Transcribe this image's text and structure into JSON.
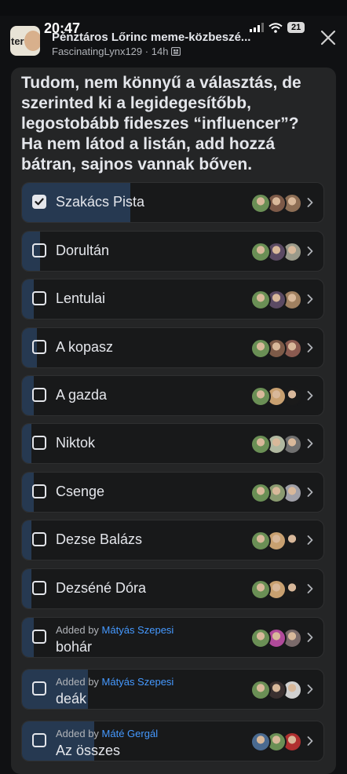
{
  "status_bar": {
    "time": "20:47",
    "battery": "21"
  },
  "header": {
    "group_avatar_text": "ter",
    "group_name": "Pénztáros Lőrinc meme-közbeszé...",
    "author": "FascinatingLynx129",
    "age": "14h",
    "separator": "·"
  },
  "poll": {
    "question": "Tudom, nem könnyű a választás, de szerinted ki a legidegesítőbb, legostobább fideszes “influencer”? Ha nem látod a listán, add hozzá bátran, sajnos vannak bőven.",
    "added_by_prefix": "Added by",
    "options": [
      {
        "label": "Szakács Pista",
        "checked": true,
        "vote_share": 0.36,
        "avatar_colors": [
          "#6a8f55",
          "#7d5a48",
          "#8d6e55"
        ]
      },
      {
        "label": "Dorultán",
        "checked": false,
        "vote_share": 0.06,
        "avatar_colors": [
          "#6a8f55",
          "#5b4a63",
          "#9a9a8a"
        ]
      },
      {
        "label": "Lentulai",
        "checked": false,
        "vote_share": 0.04,
        "avatar_colors": [
          "#6a8f55",
          "#5b4a63",
          "#a08060"
        ]
      },
      {
        "label": "A kopasz",
        "checked": false,
        "vote_share": 0.05,
        "avatar_colors": [
          "#6a8f55",
          "#7d5a48",
          "#8a5a50"
        ]
      },
      {
        "label": "A gazda",
        "checked": false,
        "vote_share": 0.04,
        "avatar_colors": [
          "#6a8f55",
          "#c8a070",
          "#1a1a1a"
        ]
      },
      {
        "label": "Niktok",
        "checked": false,
        "vote_share": 0.03,
        "avatar_colors": [
          "#6a8f55",
          "#b0b8a0",
          "#707070"
        ]
      },
      {
        "label": "Csenge",
        "checked": false,
        "vote_share": 0.04,
        "avatar_colors": [
          "#6a8f55",
          "#8a9a70",
          "#a0a0a8"
        ]
      },
      {
        "label": "Dezse Balázs",
        "checked": false,
        "vote_share": 0.03,
        "avatar_colors": [
          "#6a8f55",
          "#c8a070",
          "#1a1a1a"
        ]
      },
      {
        "label": "Dezséné Dóra",
        "checked": false,
        "vote_share": 0.03,
        "avatar_colors": [
          "#6a8f55",
          "#c8a070",
          "#1a1a1a"
        ]
      },
      {
        "label": "bohár",
        "checked": false,
        "vote_share": 0.04,
        "added_by": "Mátyás Szepesi",
        "avatar_colors": [
          "#6a8f55",
          "#b04a9a",
          "#7a6a6a"
        ]
      },
      {
        "label": "deák",
        "checked": false,
        "vote_share": 0.22,
        "added_by": "Mátyás Szepesi",
        "avatar_colors": [
          "#6a8f55",
          "#3a3030",
          "#d0d0d0"
        ]
      },
      {
        "label": "Az összes",
        "checked": false,
        "vote_share": 0.24,
        "added_by": "Máté Gergál",
        "avatar_colors": [
          "#4a6a90",
          "#6a8f55",
          "#b03030"
        ]
      }
    ]
  }
}
